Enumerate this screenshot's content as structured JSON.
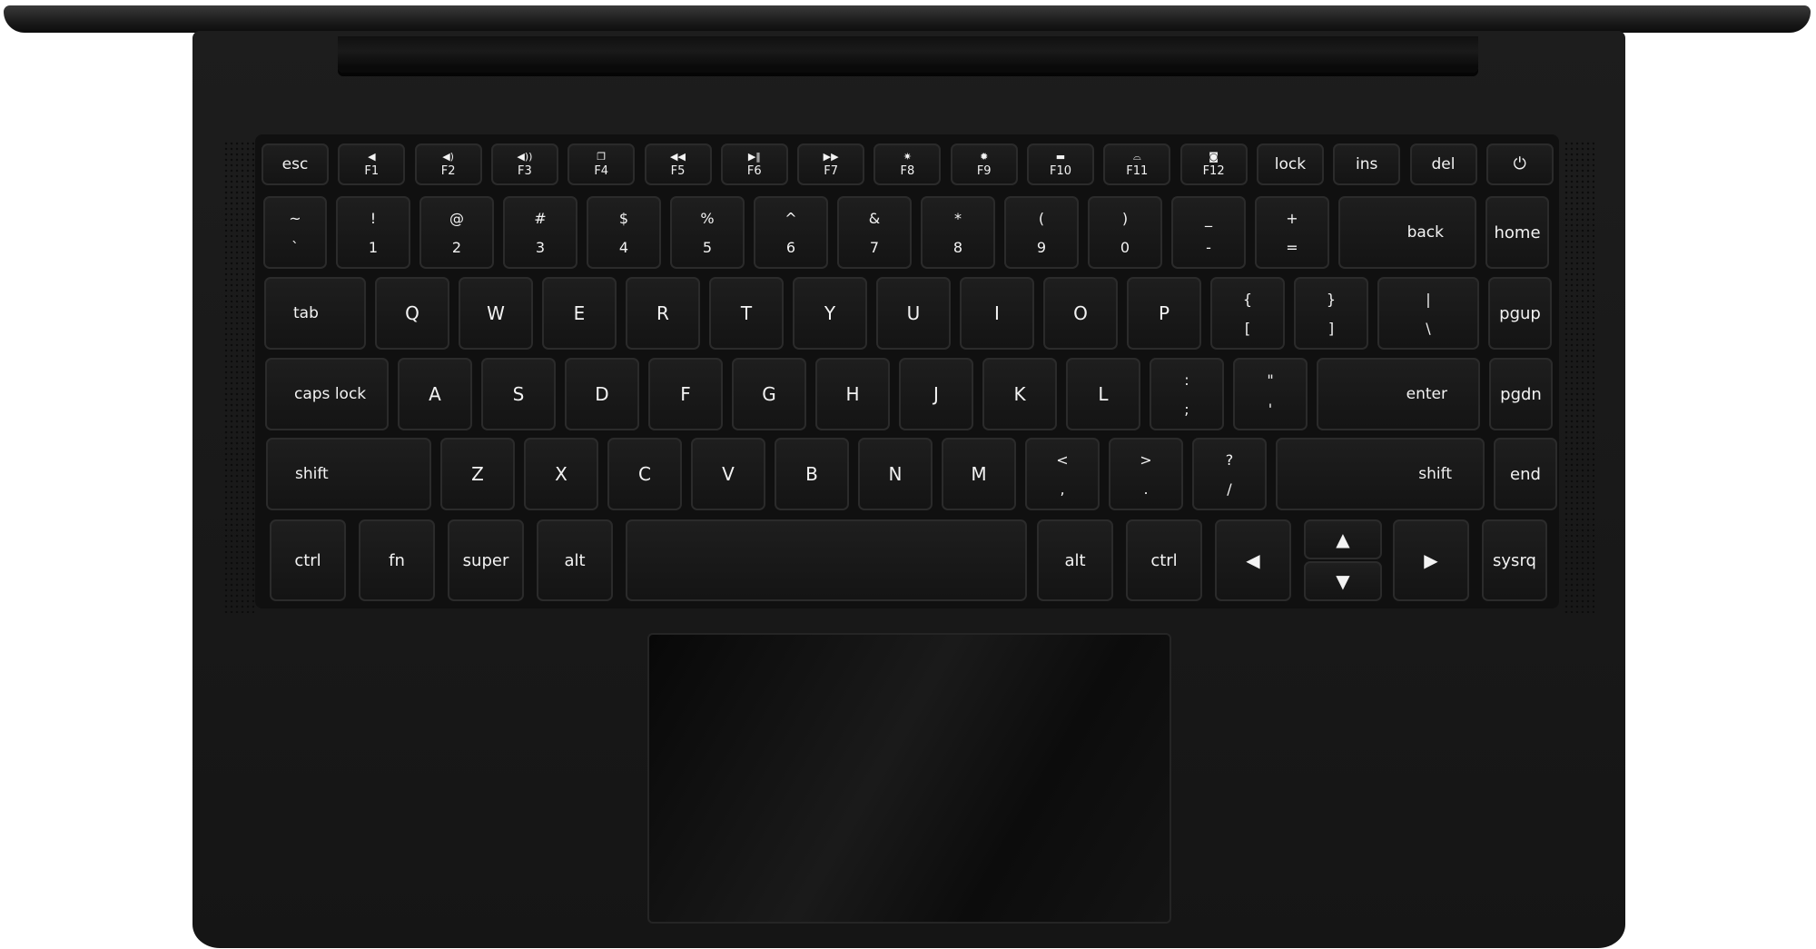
{
  "laptop": {
    "function_row": [
      {
        "id": "esc",
        "label": "esc"
      },
      {
        "id": "f1",
        "label": "F1",
        "icon": "volume-mute-icon",
        "glyph": "◀"
      },
      {
        "id": "f2",
        "label": "F2",
        "icon": "volume-down-icon",
        "glyph": "◀)"
      },
      {
        "id": "f3",
        "label": "F3",
        "icon": "volume-up-icon",
        "glyph": "◀))"
      },
      {
        "id": "f4",
        "label": "F4",
        "icon": "windows-icon",
        "glyph": "❐"
      },
      {
        "id": "f5",
        "label": "F5",
        "icon": "rewind-icon",
        "glyph": "◀◀"
      },
      {
        "id": "f6",
        "label": "F6",
        "icon": "play-pause-icon",
        "glyph": "▶‖"
      },
      {
        "id": "f7",
        "label": "F7",
        "icon": "fast-forward-icon",
        "glyph": "▶▶"
      },
      {
        "id": "f8",
        "label": "F8",
        "icon": "brightness-down-icon",
        "glyph": "✷"
      },
      {
        "id": "f9",
        "label": "F9",
        "icon": "brightness-up-icon",
        "glyph": "✹"
      },
      {
        "id": "f10",
        "label": "F10",
        "icon": "display-icon",
        "glyph": "▬"
      },
      {
        "id": "f11",
        "label": "F11",
        "icon": "keyboard-backlight-icon",
        "glyph": "⌓"
      },
      {
        "id": "f12",
        "label": "F12",
        "icon": "camera-icon",
        "glyph": "◙"
      },
      {
        "id": "lock",
        "label": "lock"
      },
      {
        "id": "ins",
        "label": "ins"
      },
      {
        "id": "del",
        "label": "del"
      },
      {
        "id": "power",
        "label": "",
        "icon": "power-icon",
        "glyph": "⏻"
      }
    ],
    "number_row": [
      {
        "id": "backtick",
        "top": "~",
        "bottom": "`"
      },
      {
        "id": "1",
        "top": "!",
        "bottom": "1"
      },
      {
        "id": "2",
        "top": "@",
        "bottom": "2"
      },
      {
        "id": "3",
        "top": "#",
        "bottom": "3"
      },
      {
        "id": "4",
        "top": "$",
        "bottom": "4"
      },
      {
        "id": "5",
        "top": "%",
        "bottom": "5"
      },
      {
        "id": "6",
        "top": "^",
        "bottom": "6"
      },
      {
        "id": "7",
        "top": "&",
        "bottom": "7"
      },
      {
        "id": "8",
        "top": "*",
        "bottom": "8"
      },
      {
        "id": "9",
        "top": "(",
        "bottom": "9"
      },
      {
        "id": "0",
        "top": ")",
        "bottom": "0"
      },
      {
        "id": "minus",
        "top": "_",
        "bottom": "-"
      },
      {
        "id": "equals",
        "top": "+",
        "bottom": "="
      },
      {
        "id": "back",
        "label": "back"
      },
      {
        "id": "home",
        "label": "home"
      }
    ],
    "qwerty_row": [
      {
        "id": "tab",
        "label": "tab"
      },
      {
        "id": "q",
        "label": "Q"
      },
      {
        "id": "w",
        "label": "W"
      },
      {
        "id": "e",
        "label": "E"
      },
      {
        "id": "r",
        "label": "R"
      },
      {
        "id": "t",
        "label": "T"
      },
      {
        "id": "y",
        "label": "Y"
      },
      {
        "id": "u",
        "label": "U"
      },
      {
        "id": "i",
        "label": "I"
      },
      {
        "id": "o",
        "label": "O"
      },
      {
        "id": "p",
        "label": "P"
      },
      {
        "id": "lbracket",
        "top": "{",
        "bottom": "["
      },
      {
        "id": "rbracket",
        "top": "}",
        "bottom": "]"
      },
      {
        "id": "backslash",
        "top": "|",
        "bottom": "\\"
      },
      {
        "id": "pgup",
        "label": "pgup"
      }
    ],
    "home_row": [
      {
        "id": "capslock",
        "label": "caps lock"
      },
      {
        "id": "a",
        "label": "A"
      },
      {
        "id": "s",
        "label": "S"
      },
      {
        "id": "d",
        "label": "D"
      },
      {
        "id": "f",
        "label": "F"
      },
      {
        "id": "g",
        "label": "G"
      },
      {
        "id": "h",
        "label": "H"
      },
      {
        "id": "j",
        "label": "J"
      },
      {
        "id": "k",
        "label": "K"
      },
      {
        "id": "l",
        "label": "L"
      },
      {
        "id": "semicolon",
        "top": ":",
        "bottom": ";"
      },
      {
        "id": "quote",
        "top": "\"",
        "bottom": "'"
      },
      {
        "id": "enter",
        "label": "enter"
      },
      {
        "id": "pgdn",
        "label": "pgdn"
      }
    ],
    "shift_row": [
      {
        "id": "lshift",
        "label": "shift"
      },
      {
        "id": "z",
        "label": "Z"
      },
      {
        "id": "x",
        "label": "X"
      },
      {
        "id": "c",
        "label": "C"
      },
      {
        "id": "v",
        "label": "V"
      },
      {
        "id": "b",
        "label": "B"
      },
      {
        "id": "n",
        "label": "N"
      },
      {
        "id": "m",
        "label": "M"
      },
      {
        "id": "comma",
        "top": "<",
        "bottom": ","
      },
      {
        "id": "period",
        "top": ">",
        "bottom": "."
      },
      {
        "id": "slash",
        "top": "?",
        "bottom": "/"
      },
      {
        "id": "rshift",
        "label": "shift"
      },
      {
        "id": "end",
        "label": "end"
      }
    ],
    "bottom_row": [
      {
        "id": "lctrl",
        "label": "ctrl"
      },
      {
        "id": "fn",
        "label": "fn"
      },
      {
        "id": "super",
        "label": "super"
      },
      {
        "id": "lalt",
        "label": "alt"
      },
      {
        "id": "space",
        "label": ""
      },
      {
        "id": "ralt",
        "label": "alt"
      },
      {
        "id": "rctrl",
        "label": "ctrl"
      },
      {
        "id": "left",
        "label": "",
        "icon": "arrow-left-icon",
        "glyph": "◀"
      },
      {
        "id": "up",
        "label": "",
        "icon": "arrow-up-icon",
        "glyph": "▲"
      },
      {
        "id": "down",
        "label": "",
        "icon": "arrow-down-icon",
        "glyph": "▼"
      },
      {
        "id": "right",
        "label": "",
        "icon": "arrow-right-icon",
        "glyph": "▶"
      },
      {
        "id": "sysrq",
        "label": "sysrq"
      }
    ]
  }
}
